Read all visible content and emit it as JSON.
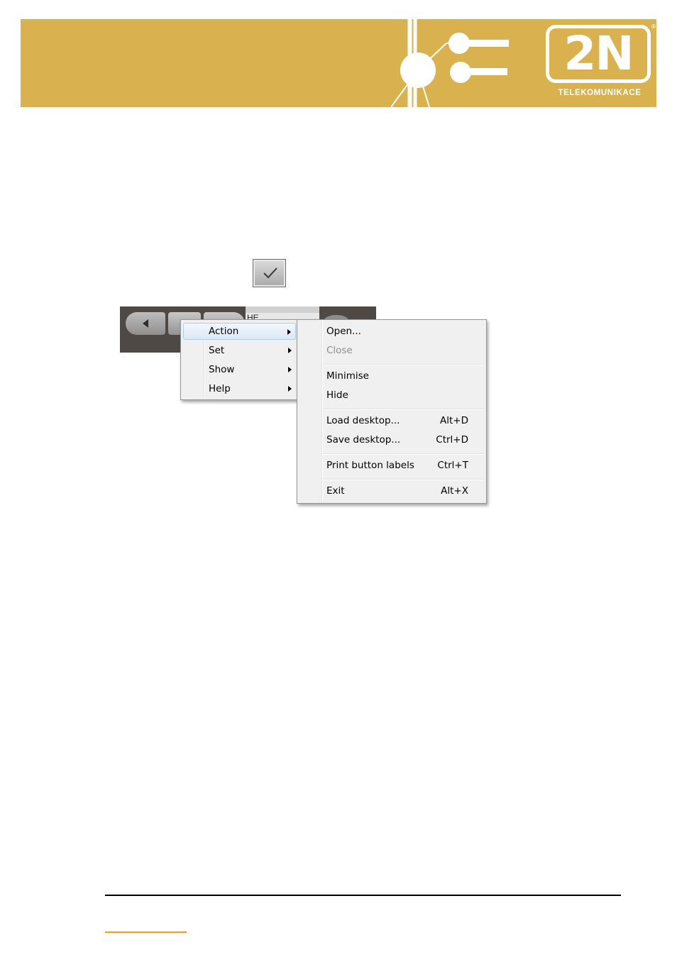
{
  "colors": {
    "banner": "#d9b14f",
    "footer_mark": "#f0a020",
    "menu_highlight": "#dbe9f7"
  },
  "logo": {
    "mark": "2N",
    "tagline": "TELEKOMUNIKACE",
    "registered": "®"
  },
  "check_button": {
    "icon": "checkmark-icon"
  },
  "toolbar": {
    "display_text": "HE"
  },
  "main_menu": {
    "items": [
      {
        "label": "Action",
        "has_submenu": true,
        "highlighted": true
      },
      {
        "label": "Set",
        "has_submenu": true
      },
      {
        "label": "Show",
        "has_submenu": true
      },
      {
        "label": "Help",
        "has_submenu": true
      }
    ]
  },
  "action_menu": {
    "items": [
      {
        "label": "Open...",
        "shortcut": ""
      },
      {
        "label": "Close",
        "shortcut": "",
        "disabled": true
      },
      {
        "label": "Minimise",
        "shortcut": ""
      },
      {
        "label": "Hide",
        "shortcut": ""
      },
      {
        "label": "Load desktop...",
        "shortcut": "Alt+D"
      },
      {
        "label": "Save desktop...",
        "shortcut": "Ctrl+D"
      },
      {
        "label": "Print button labels",
        "shortcut": "Ctrl+T"
      },
      {
        "label": "Exit",
        "shortcut": "Alt+X"
      }
    ]
  }
}
